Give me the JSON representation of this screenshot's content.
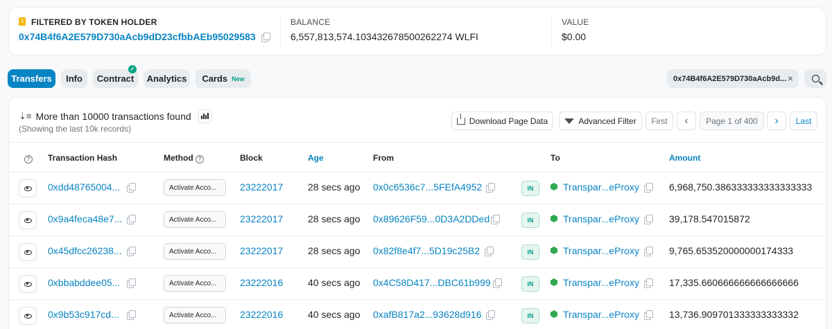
{
  "header": {
    "filter_label": "FILTERED BY TOKEN HOLDER",
    "holder_address": "0x74B4f6A2E579D730aAcb9dD23cfbbAEb95029583",
    "balance_label": "BALANCE",
    "balance_value": "6,557,813,574.103432678500262274 WLFI",
    "value_label": "VALUE",
    "value_value": "$0.00"
  },
  "tabs": [
    {
      "label": "Transfers",
      "active": true
    },
    {
      "label": "Info"
    },
    {
      "label": "Contract",
      "verified": true
    },
    {
      "label": "Analytics"
    },
    {
      "label": "Cards",
      "badge": "New"
    }
  ],
  "filter_chip": {
    "text": "0x74B4f6A2E579D730aAcb9d...",
    "close": "×"
  },
  "summary": {
    "title": "More than 10000 transactions found",
    "subtitle": "(Showing the last 10k records)"
  },
  "toolbar": {
    "download": "Download Page Data",
    "advanced_filter": "Advanced Filter",
    "first": "First",
    "prev": "‹",
    "page_info": "Page 1 of 400",
    "next": "›",
    "last": "Last"
  },
  "columns": {
    "hash": "Transaction Hash",
    "method": "Method",
    "block": "Block",
    "age": "Age",
    "from": "From",
    "to": "To",
    "amount": "Amount"
  },
  "rows": [
    {
      "hash": "0xdd48765004...",
      "method": "Activate Acco...",
      "block": "23222017",
      "age": "28 secs ago",
      "from": "0x0c6536c7...5FEfA4952",
      "dir": "IN",
      "to": "Transpar...eProxy",
      "amount": "6,968,750.386333333333333333"
    },
    {
      "hash": "0x9a4feca48e7...",
      "method": "Activate Acco...",
      "block": "23222017",
      "age": "28 secs ago",
      "from": "0x89626F59...0D3A2DDed",
      "dir": "IN",
      "to": "Transpar...eProxy",
      "amount": "39,178.547015872"
    },
    {
      "hash": "0x45dfcc26238...",
      "method": "Activate Acco...",
      "block": "23222017",
      "age": "28 secs ago",
      "from": "0x82f8e4f7...5D19c25B2",
      "dir": "IN",
      "to": "Transpar...eProxy",
      "amount": "9,765.653520000000174333"
    },
    {
      "hash": "0xbbabddee05...",
      "method": "Activate Acco...",
      "block": "23222016",
      "age": "40 secs ago",
      "from": "0x4C58D417...DBC61b999",
      "dir": "IN",
      "to": "Transpar...eProxy",
      "amount": "17,335.660666666666666666"
    },
    {
      "hash": "0x9b53c917cd...",
      "method": "Activate Acco...",
      "block": "23222016",
      "age": "40 secs ago",
      "from": "0xafB817a2...93628d916",
      "dir": "IN",
      "to": "Transpar...eProxy",
      "amount": "13,736.909701333333333332"
    }
  ],
  "colors": {
    "accent": "#0784c3",
    "success": "#00a186",
    "token": "#f2b705"
  }
}
